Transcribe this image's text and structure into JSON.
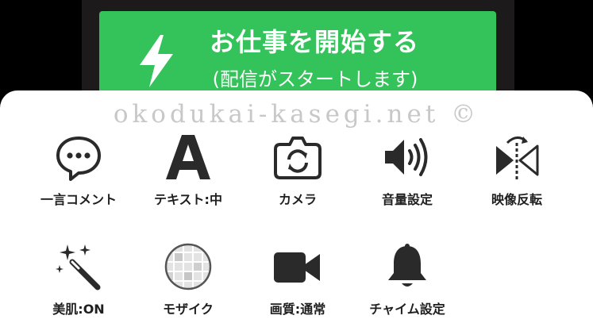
{
  "start_button": {
    "title": "お仕事を開始する",
    "subtitle": "(配信がスタートします)",
    "icon": "lightning-bolt-icon",
    "color": "#34c35a"
  },
  "watermark": "okodukai-kasegi.net ©",
  "menu": {
    "items": [
      {
        "label": "一言コメント",
        "icon": "speech-bubble-icon"
      },
      {
        "label": "テキスト:中",
        "icon": "letter-a-icon"
      },
      {
        "label": "カメラ",
        "icon": "camera-switch-icon"
      },
      {
        "label": "音量設定",
        "icon": "speaker-volume-icon"
      },
      {
        "label": "映像反転",
        "icon": "flip-video-icon"
      },
      {
        "label": "美肌:ON",
        "icon": "magic-wand-icon"
      },
      {
        "label": "モザイク",
        "icon": "mosaic-grid-icon"
      },
      {
        "label": "画質:通常",
        "icon": "video-camera-icon"
      },
      {
        "label": "チャイム設定",
        "icon": "bell-icon"
      }
    ]
  },
  "colors": {
    "icon": "#2a2a2a",
    "sheet_bg": "#ffffff",
    "top_bg": "#1c1a1b"
  }
}
